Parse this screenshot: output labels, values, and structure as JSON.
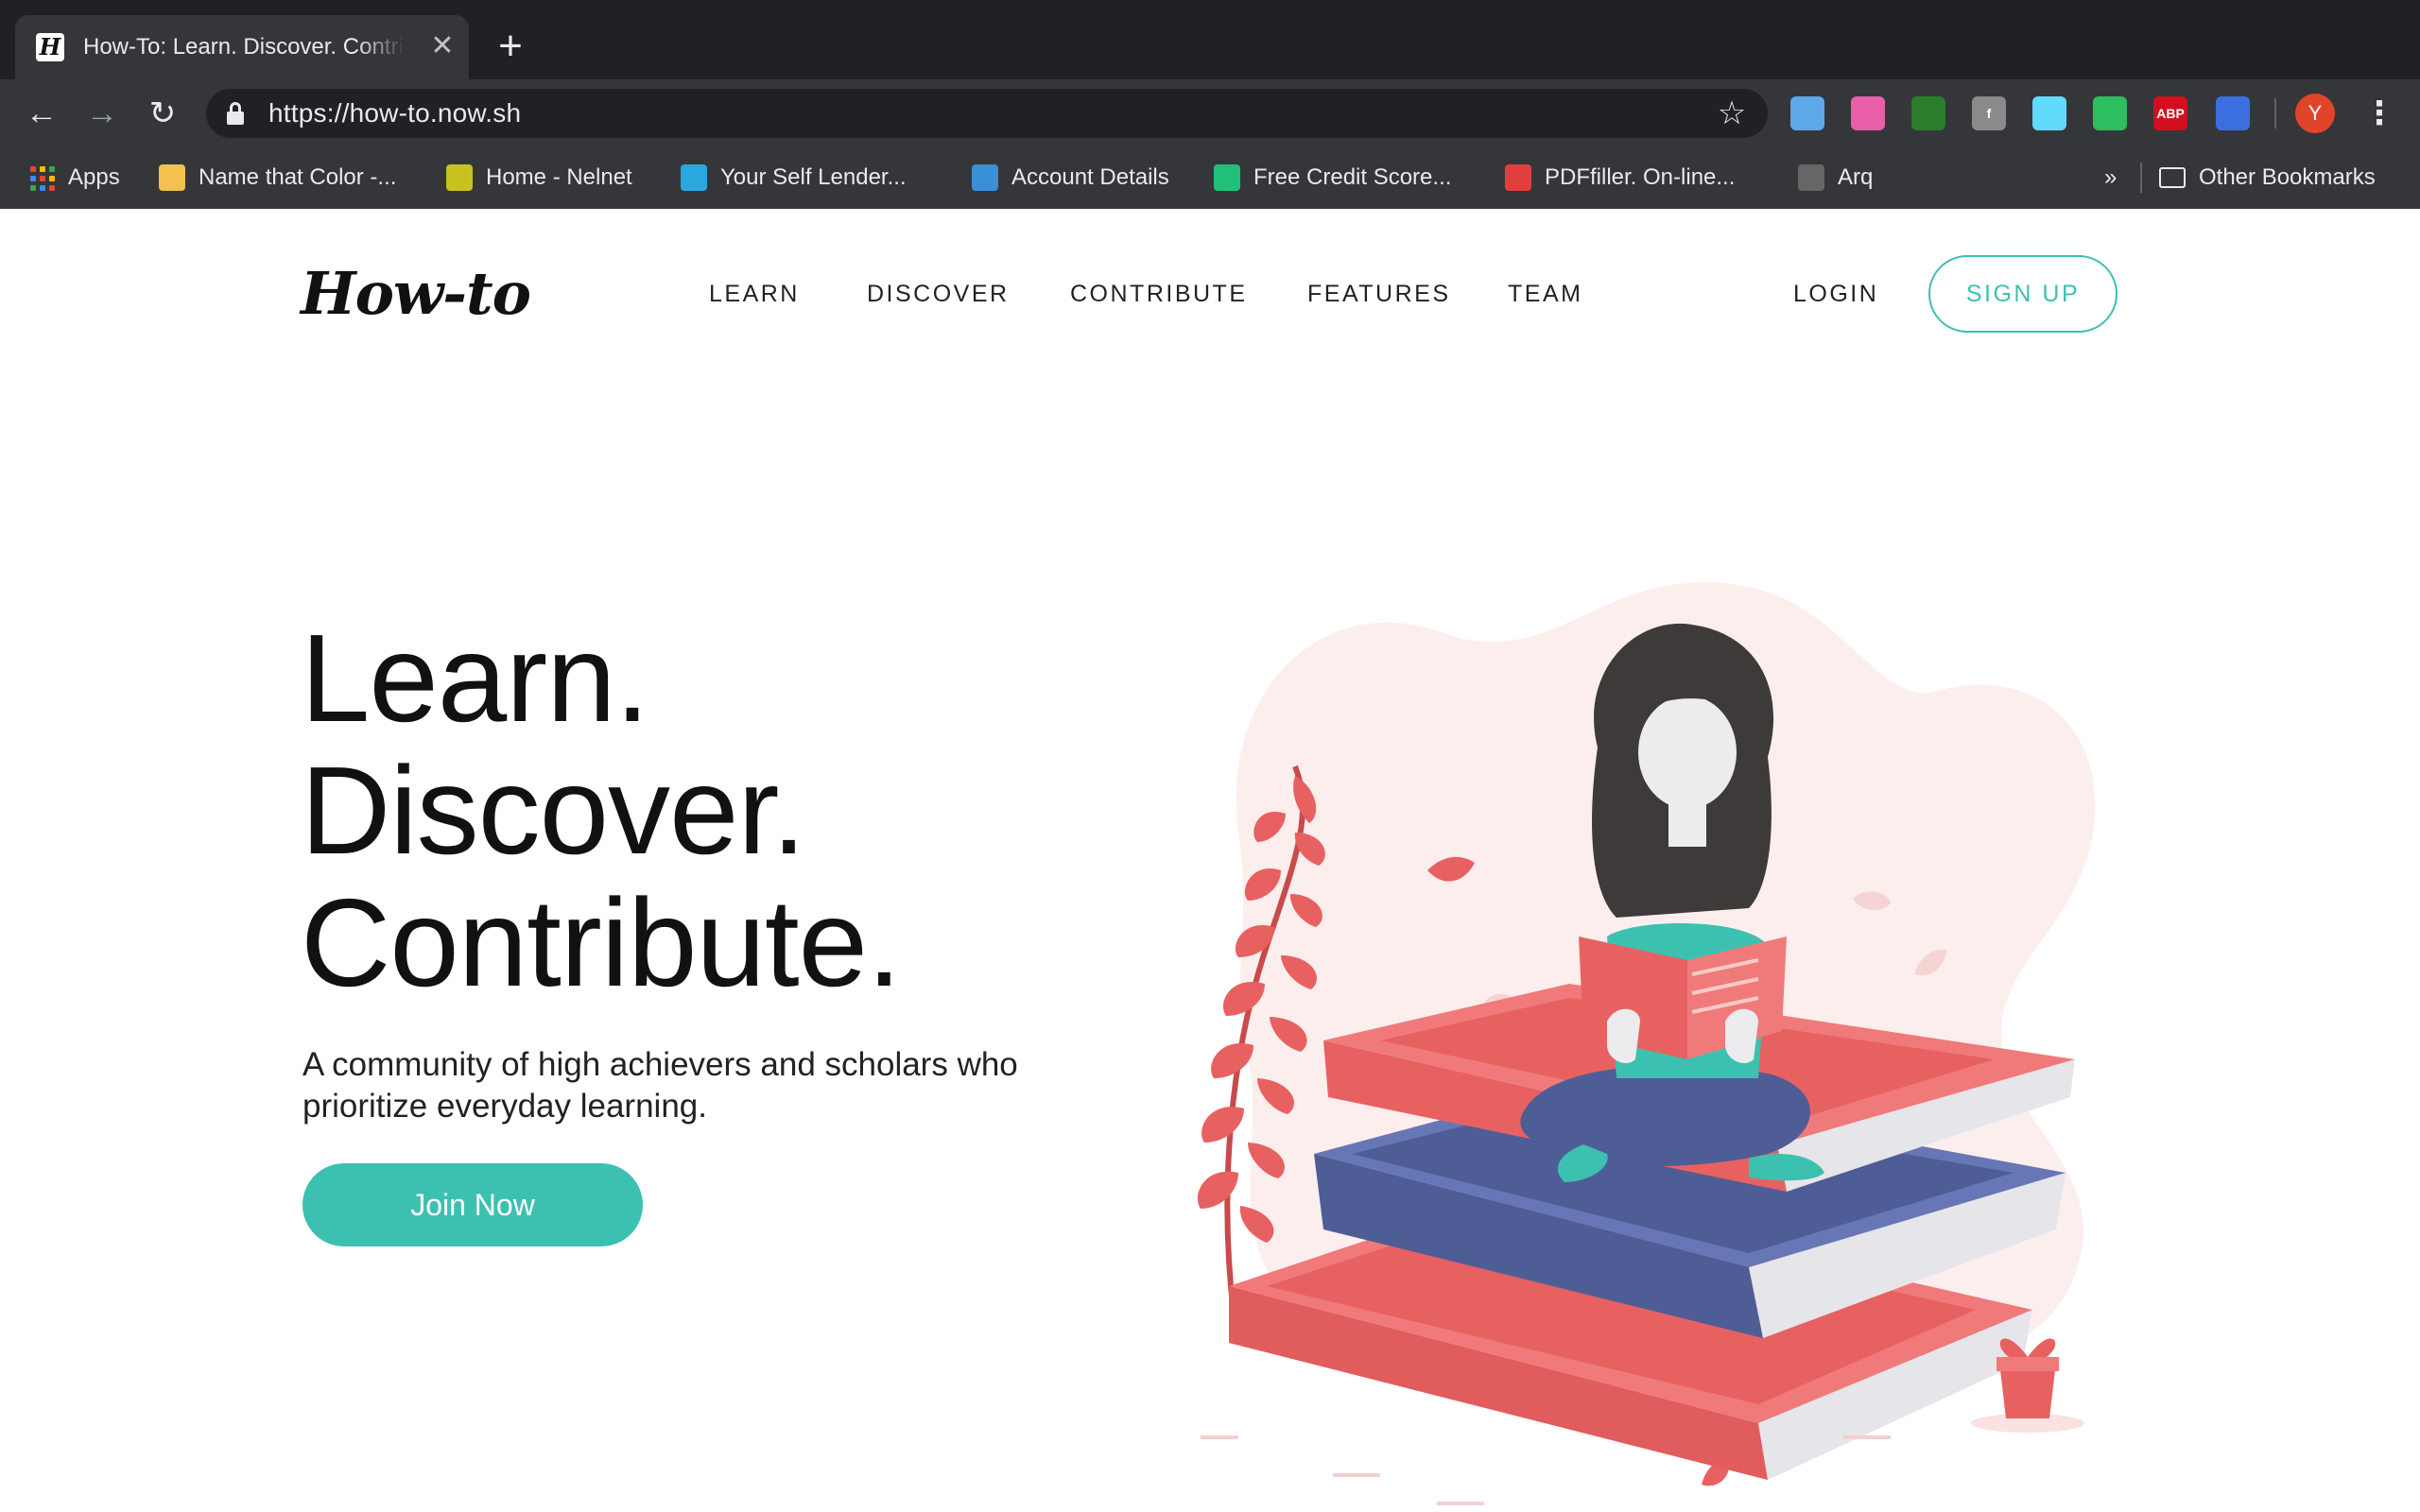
{
  "browser": {
    "tab": {
      "title": "How-To: Learn. Discover. Contribute.",
      "favicon_letter": "H"
    },
    "new_tab_icon": "+",
    "toolbar": {
      "url": "https://how-to.now.sh",
      "avatar_letter": "Y"
    },
    "extensions": [
      {
        "name": "sketch-icon",
        "color": "#5ea7e8",
        "label": ""
      },
      {
        "name": "color-gradient-icon",
        "color": "#e85fa8",
        "label": ""
      },
      {
        "name": "screenshot-icon",
        "color": "#2b7d2b",
        "label": ""
      },
      {
        "name": "facebook-icon",
        "color": "#8a8a8a",
        "label": "f"
      },
      {
        "name": "react-icon",
        "color": "#61dafb",
        "label": ""
      },
      {
        "name": "evernote-icon",
        "color": "#2dbe60",
        "label": ""
      },
      {
        "name": "adblock-icon",
        "color": "#d20f1e",
        "label": "ABP"
      },
      {
        "name": "eyedropper-icon",
        "color": "#3b6fe0",
        "label": ""
      }
    ],
    "bookmarks": [
      {
        "label": "Apps",
        "icon": "apps-grid-icon",
        "color": ""
      },
      {
        "label": "Name that Color -...",
        "icon": "name-that-color-icon",
        "color": "#f2c14e"
      },
      {
        "label": "Home - Nelnet",
        "icon": "nelnet-icon",
        "color": "#c7c21f"
      },
      {
        "label": "Your Self Lender...",
        "icon": "self-lender-icon",
        "color": "#2aa7df"
      },
      {
        "label": "Account Details",
        "icon": "account-details-icon",
        "color": "#3b8fd6"
      },
      {
        "label": "Free Credit Score...",
        "icon": "credit-karma-icon",
        "color": "#21c07a"
      },
      {
        "label": "PDFfiller. On-line...",
        "icon": "pdffiller-icon",
        "color": "#e23e3e"
      },
      {
        "label": "Arq",
        "icon": "arq-icon",
        "color": "#666666"
      }
    ],
    "bookmarks_overflow": "»",
    "other_bookmarks": "Other Bookmarks"
  },
  "site": {
    "logo": "How-to",
    "nav": [
      "LEARN",
      "DISCOVER",
      "CONTRIBUTE",
      "FEATURES",
      "TEAM"
    ],
    "login": "LOGIN",
    "signup": "SIGN UP"
  },
  "hero": {
    "lines": [
      "Learn.",
      "Discover.",
      "Contribute."
    ],
    "subtitle": "A community of high achievers and scholars who prioritize everyday learning.",
    "cta": "Join Now"
  },
  "colors": {
    "accent": "#3cc1b1",
    "book_red": "#e86161",
    "book_blue": "#4f5d96",
    "blob_pink": "#fdeeee",
    "hair": "#3f3a3a"
  }
}
